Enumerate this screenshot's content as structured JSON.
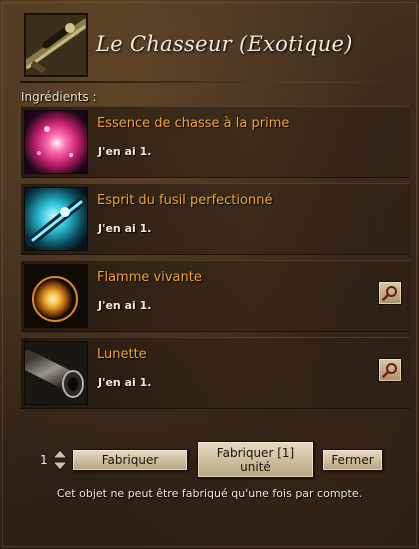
{
  "header": {
    "title": "Le Chasseur (Exotique)",
    "icon": "rifle-icon"
  },
  "ingredients_label": "Ingrédients :",
  "ingredients": [
    {
      "name": "Essence de chasse à la prime",
      "owned": "J'en ai 1.",
      "icon": "bounty-essence-icon",
      "has_search": false
    },
    {
      "name": "Esprit du fusil perfectionné",
      "owned": "J'en ai 1.",
      "icon": "rifle-spirit-icon",
      "has_search": false
    },
    {
      "name": "Flamme vivante",
      "owned": "J'en ai 1.",
      "icon": "living-flame-icon",
      "has_search": true
    },
    {
      "name": "Lunette",
      "owned": "J'en ai 1.",
      "icon": "scope-icon",
      "has_search": true
    }
  ],
  "footer": {
    "quantity": "1",
    "craft_label": "Fabriquer",
    "craft_unit_label": "Fabriquer [1] unité",
    "close_label": "Fermer",
    "notice": "Cet objet ne peut être fabriqué qu'une fois par compte."
  },
  "colors": {
    "ingredient_name": "#f0a432",
    "title": "#f4ecda",
    "button_face": "#d8cbae"
  }
}
